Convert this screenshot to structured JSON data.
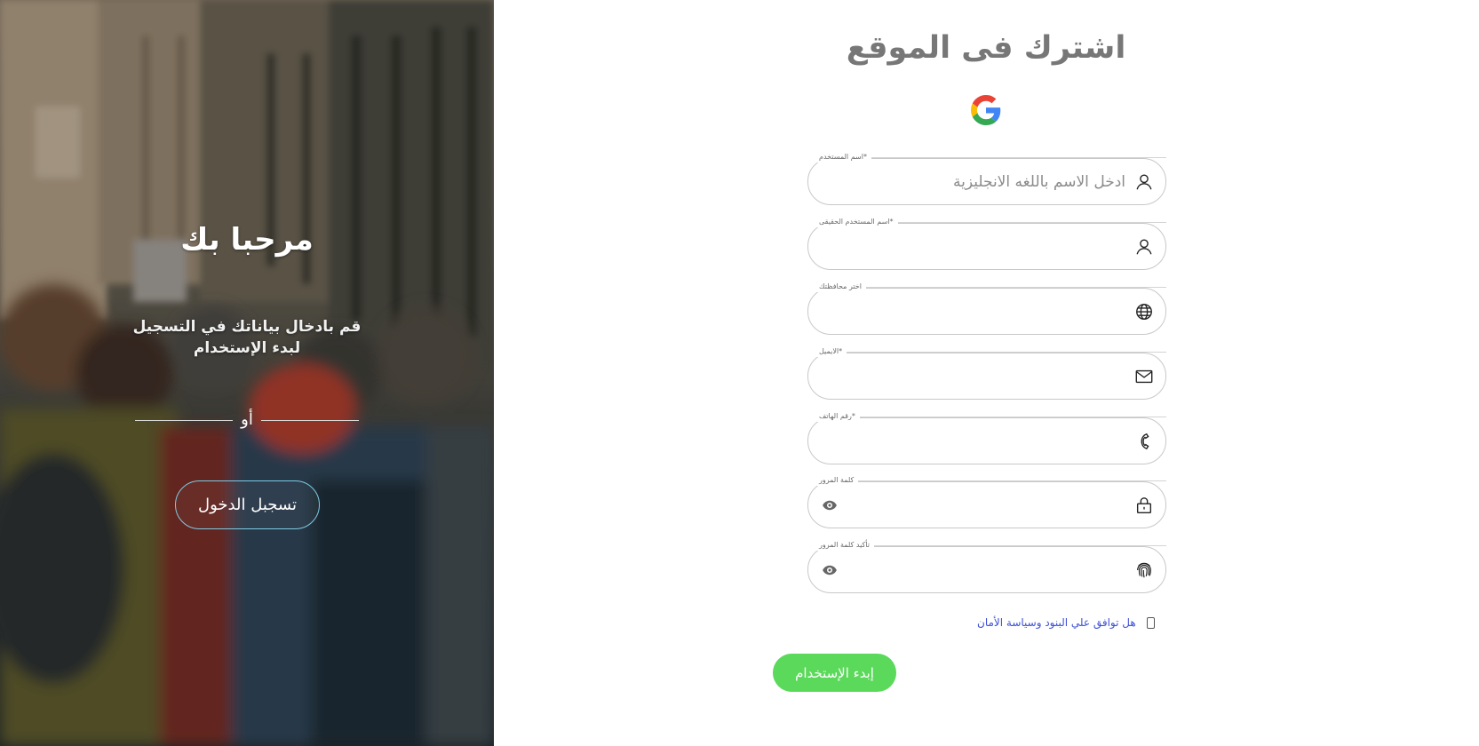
{
  "welcome": {
    "title": "مرحبا بك",
    "text": "قم بادخال بياناتك في التسجيل لبدء الإستخدام",
    "divider": "أو",
    "login_button": "تسجبل الدخول"
  },
  "form": {
    "title": "اشترك فى الموقع",
    "google_icon": "google-g-icon",
    "fields": [
      {
        "label": "اسم المستخدم*",
        "placeholder": "ادخل الاسم باللغه الانجليزية",
        "value": "",
        "icon": "user-icon"
      },
      {
        "label": "اسم المستخدم الحقيقى*",
        "placeholder": "",
        "value": "",
        "icon": "user-icon"
      },
      {
        "label": "اختر محافظتك",
        "placeholder": "",
        "value": "",
        "icon": "globe-icon"
      },
      {
        "label": "الايميل*",
        "placeholder": "",
        "value": "",
        "icon": "mail-icon"
      },
      {
        "label": "رقم الهاتف*",
        "placeholder": "",
        "value": "",
        "icon": "phone-icon"
      },
      {
        "label": "كلمة المرور",
        "placeholder": "",
        "value": "",
        "icon": "lock-icon",
        "toggle_icon": "eye-icon"
      },
      {
        "label": "تأكيد كلمة المرور",
        "placeholder": "",
        "value": "",
        "icon": "fingerprint-icon",
        "toggle_icon": "eye-icon"
      }
    ],
    "terms_label": "هل توافق علي البنود وسياسة الأمان",
    "terms_checked": false,
    "submit_button": "إبدء الإستخدام"
  },
  "colors": {
    "title": "#777777",
    "submit": "#5bd95b",
    "terms_link": "#3d50d6",
    "login_border": "#7ecbe3"
  }
}
